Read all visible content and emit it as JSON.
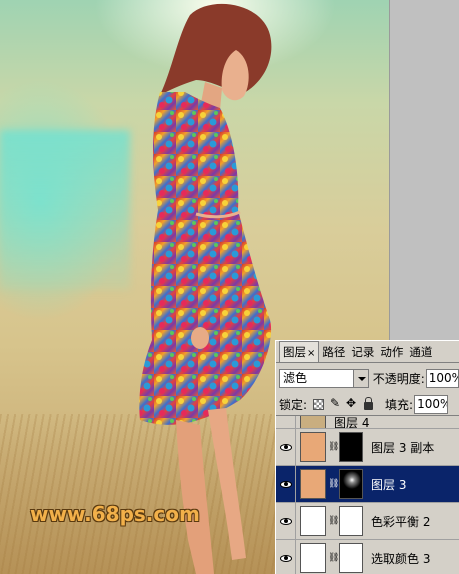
{
  "layers_panel": {
    "tabs": [
      {
        "label": "图层",
        "active": true
      },
      {
        "label": "路径",
        "active": false
      },
      {
        "label": "记录",
        "active": false
      },
      {
        "label": "动作",
        "active": false
      },
      {
        "label": "通道",
        "active": false
      }
    ],
    "close_symbol": "×",
    "blend_mode": "滤色",
    "opacity_label": "不透明度:",
    "opacity_value": "100%",
    "lock_label": "锁定:",
    "fill_label": "填充:",
    "fill_value": "100%",
    "layers": [
      {
        "name": "图层 4",
        "thumb": "tan",
        "mask": "none",
        "selected": false,
        "partial": true
      },
      {
        "name": "图层 3 副本",
        "thumb": "skin",
        "mask": "black",
        "selected": false
      },
      {
        "name": "图层 3",
        "thumb": "skin",
        "mask": "black-glow",
        "selected": true
      },
      {
        "name": "色彩平衡 2",
        "thumb": "adjust",
        "mask": "white",
        "selected": false
      },
      {
        "name": "选取颜色 3",
        "thumb": "adjust",
        "mask": "white",
        "selected": false
      }
    ]
  },
  "watermark": "www.68ps.com",
  "colors": {
    "selection": "#0a246a",
    "panel_bg": "#d4d0c8",
    "watermark": "#f2b04a"
  }
}
